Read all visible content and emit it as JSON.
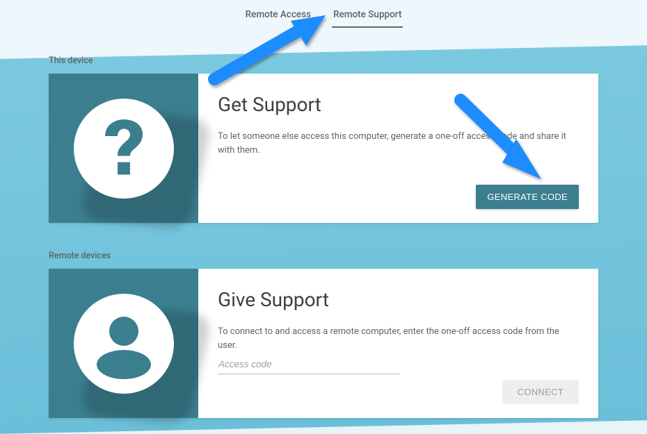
{
  "tabs": {
    "remote_access": "Remote Access",
    "remote_support": "Remote Support"
  },
  "sections": {
    "this_device_label": "This device",
    "remote_devices_label": "Remote devices"
  },
  "get_support": {
    "title": "Get Support",
    "description": "To let someone else access this computer, generate a one-off access code and share it with them.",
    "button": "GENERATE CODE"
  },
  "give_support": {
    "title": "Give Support",
    "description": "To connect to and access a remote computer, enter the one-off access code from the user.",
    "input_placeholder": "Access code",
    "button": "CONNECT"
  },
  "colors": {
    "teal": "#3b7f8f",
    "arrow": "#1a8cff"
  }
}
